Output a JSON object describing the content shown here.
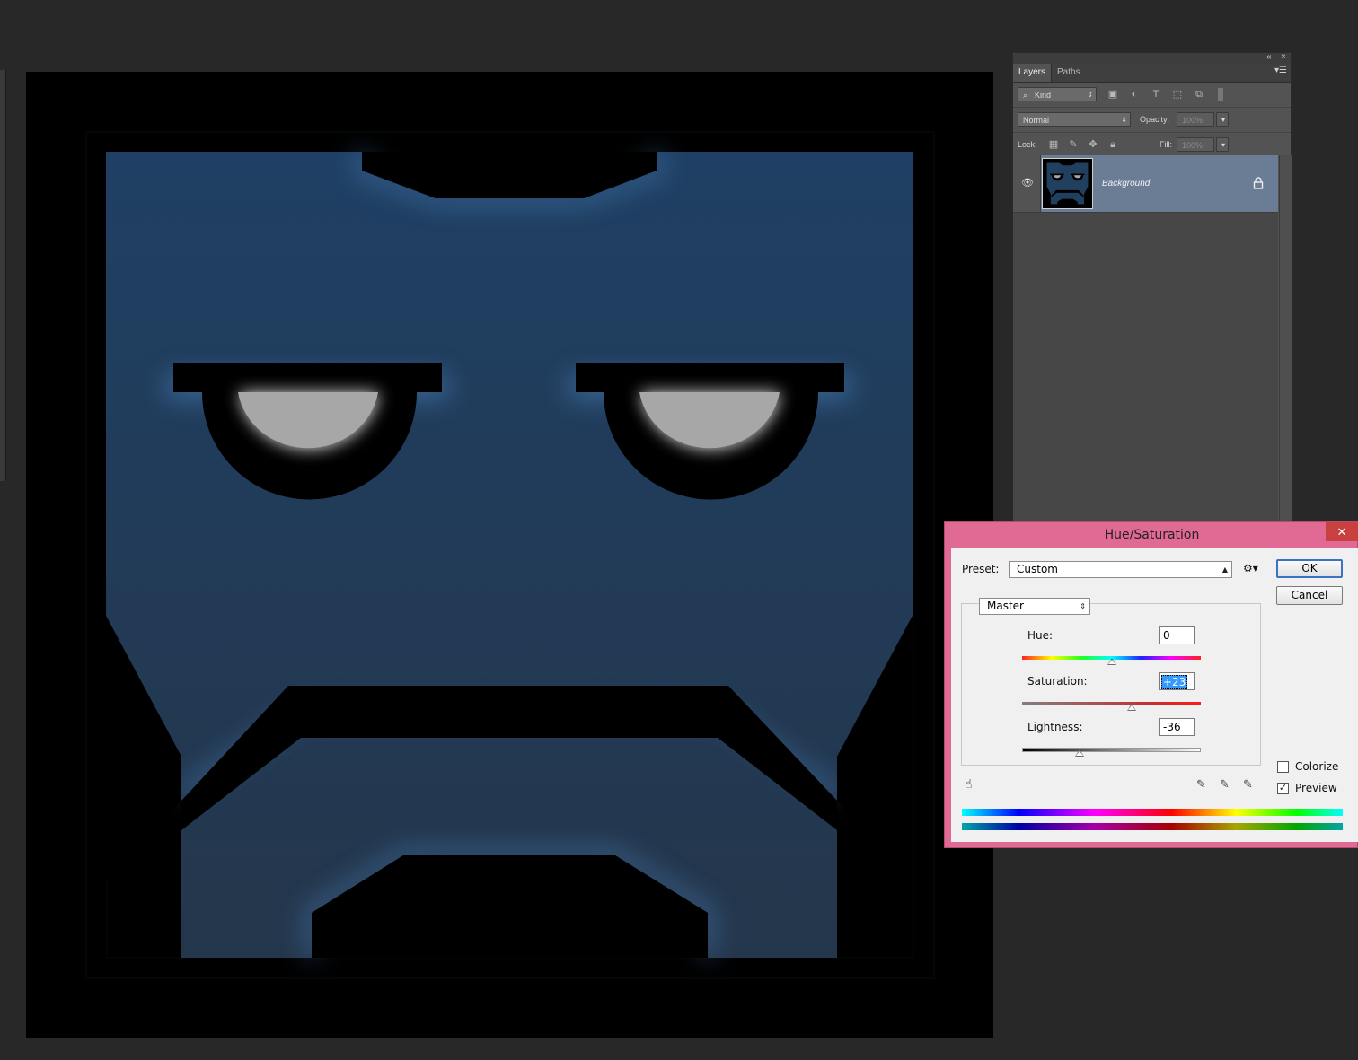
{
  "layers_panel": {
    "tabs": [
      "Layers",
      "Paths"
    ],
    "filter_kind": "Kind",
    "blend_mode": "Normal",
    "opacity_label": "Opacity:",
    "opacity_value": "100%",
    "lock_label": "Lock:",
    "fill_label": "Fill:",
    "fill_value": "100%",
    "layers": [
      {
        "name": "Background",
        "visible": true,
        "locked": true
      }
    ],
    "icons": [
      "search-icon",
      "image-filter-icon",
      "adjustment-filter-icon",
      "type-filter-icon",
      "shape-filter-icon",
      "smart-object-filter-icon",
      "lock-pixels-icon",
      "lock-image-icon",
      "lock-position-icon",
      "lock-all-icon",
      "eye-icon",
      "lock-icon"
    ]
  },
  "dialog": {
    "title": "Hue/Saturation",
    "close": "✕",
    "preset_label": "Preset:",
    "preset_value": "Custom",
    "channel": "Master",
    "ok": "OK",
    "cancel": "Cancel",
    "hue": {
      "label": "Hue:",
      "value": "0",
      "level": 0.5
    },
    "saturation": {
      "label": "Saturation:",
      "value": "+23",
      "level": 0.615
    },
    "lightness": {
      "label": "Lightness:",
      "value": "-36",
      "level": 0.32
    },
    "colorize": {
      "label": "Colorize",
      "checked": false
    },
    "preview": {
      "label": "Preview",
      "checked": true
    },
    "colors": {
      "frame": "#e06a93",
      "selection": "#3399ff"
    }
  },
  "canvas": {
    "colors": {
      "background": "#000000",
      "mask_blue": "#21405f",
      "eye": "#a7a7a7"
    }
  }
}
